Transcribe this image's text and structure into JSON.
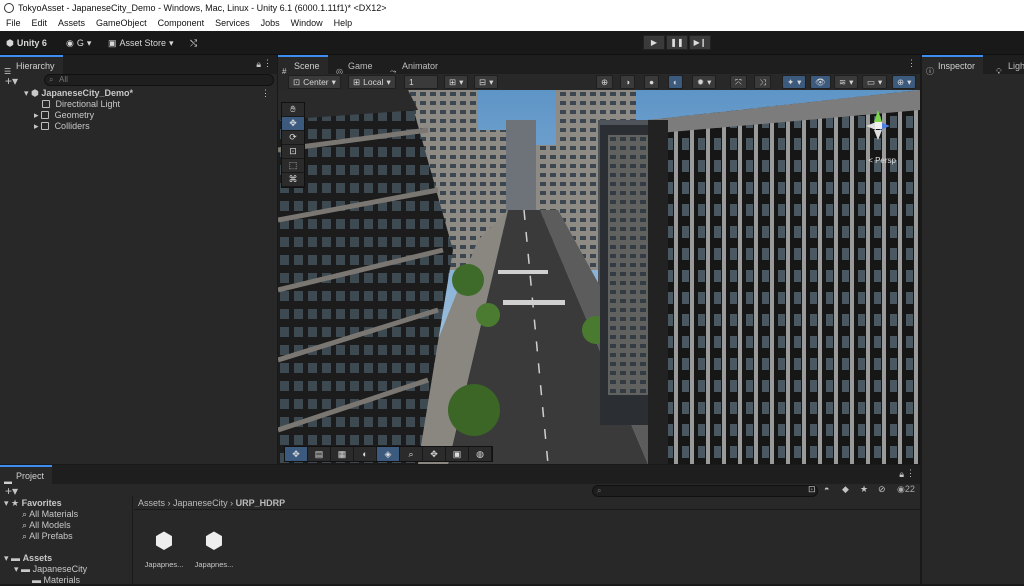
{
  "window": {
    "title": "TokyoAsset - JapaneseCity_Demo - Windows, Mac, Linux - Unity 6.1 (6000.1.11f1)* <DX12>"
  },
  "menu": [
    "File",
    "Edit",
    "Assets",
    "GameObject",
    "Component",
    "Services",
    "Jobs",
    "Window",
    "Help"
  ],
  "toolbar": {
    "unity_label": "Unity 6",
    "account_label": "G",
    "asset_store_label": "Asset Store"
  },
  "hierarchy": {
    "tab_label": "Hierarchy",
    "search_placeholder": "All",
    "scene": "JapaneseCity_Demo*",
    "items": [
      "Directional Light",
      "Geometry",
      "Colliders"
    ]
  },
  "scene_tabs": [
    "Scene",
    "Game",
    "Animator"
  ],
  "scene_toolbar": {
    "pivot": "Center",
    "space": "Local",
    "grid_value": "1"
  },
  "viewport": {
    "persp_label": "< Persp"
  },
  "inspector": {
    "tabs": [
      "Inspector",
      "Ligh"
    ]
  },
  "project": {
    "tab_label": "Project",
    "favorites_label": "Favorites",
    "favorites": [
      "All Materials",
      "All Models",
      "All Prefabs"
    ],
    "assets_label": "Assets",
    "tree": [
      "JapaneseCity",
      "Materials"
    ],
    "breadcrumb": [
      "Assets",
      "JapaneseCity",
      "URP_HDRP"
    ],
    "count": "22",
    "assets": [
      "Japapnes...",
      "Japapnes..."
    ]
  },
  "colors": {
    "accent": "#3d8ef0",
    "panel": "#282828",
    "sky": "#87b4d9"
  }
}
